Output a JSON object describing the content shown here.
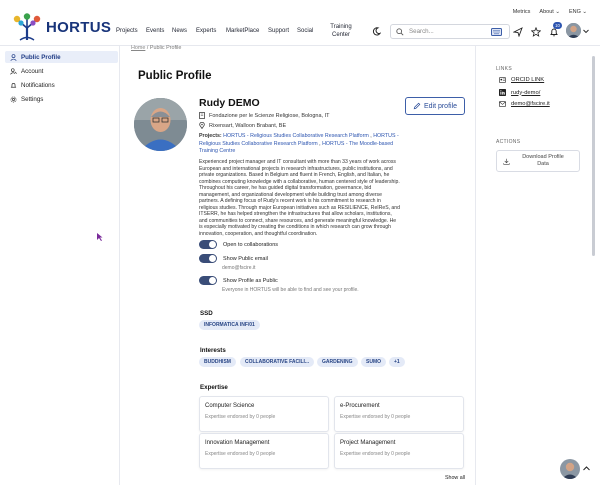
{
  "header": {
    "app_name": "HORTUS",
    "top_links": [
      "Metrics",
      "About ⌄",
      "ENG ⌄"
    ],
    "nav": [
      "Projects",
      "Events",
      "News",
      "Experts",
      "MarketPlace",
      "Support",
      "Social"
    ],
    "nav_training": "Training Center",
    "search_placeholder": "Search...",
    "notification_count": "10"
  },
  "breadcrumb": {
    "home": "Home",
    "sep": " / ",
    "current": "Public Profile"
  },
  "sidebar": {
    "items": [
      {
        "label": "Public Profile",
        "icon": "person-icon",
        "active": true
      },
      {
        "label": "Account",
        "icon": "account-icon",
        "active": false
      },
      {
        "label": "Notifications",
        "icon": "bell-icon",
        "active": false
      },
      {
        "label": "Settings",
        "icon": "gear-icon",
        "active": false
      }
    ]
  },
  "profile": {
    "page_title": "Public Profile",
    "name": "Rudy DEMO",
    "organization": "Fondazione per le Scienze Religiose, Bologna, IT",
    "location": "Rixensart, Walloon Brabant, BE",
    "edit_label": "Edit profile",
    "projects_label": "Projects:",
    "projects": [
      "HORTUS - Religious Studies Collaborative Research Platform",
      "HORTUS - Religious Studies Collaborative Research Platform",
      "HORTUS - The Moodle-based Training Centre"
    ],
    "bio": "Experienced project manager and IT consultant with more than 33 years of work across European and international projects in research infrastructures, public institutions, and private organizations. Based in Belgium and fluent in French, English, and Italian, he combines computing knowledge with a collaborative, human centered style of leadership. Throughout his career, he has guided digital transformation, governance, bid management, and organizational development while building trust among diverse partners. A defining focus of Rudy's recent work is his commitment to research in religious studies. Through major European initiatives such as RESILIENCE, ReIReS, and ITSERR, he has helped strengthen the infrastructures that allow scholars, institutions, and communities to connect, share resources, and generate meaningful knowledge. He is especially motivated by creating the conditions in which research can grow through innovation, cooperation, and thoughtful coordination.",
    "toggles": [
      {
        "label": "Open to collaborations",
        "on": true
      },
      {
        "label": "Show Public email",
        "on": true,
        "sub": "demo@fscire.it"
      },
      {
        "label": "Show Profile as Public",
        "on": true,
        "sub": "Everyone in HORTUS will be able to find and see your profile."
      }
    ],
    "ssd_title": "SSD",
    "ssd": [
      "INFORMATICA INF/01"
    ],
    "interests_title": "Interests",
    "interests": [
      "BUDDHISM",
      "COLLABORATIVE FACILI...",
      "GARDENING",
      "SUMO",
      "+1"
    ],
    "expertise_title": "Expertise",
    "expertise": [
      {
        "title": "Computer Science",
        "sub": "Expertise endorsed by 0 people"
      },
      {
        "title": "e-Procurement",
        "sub": "Expertise endorsed by 0 people"
      },
      {
        "title": "Innovation Management",
        "sub": "Expertise endorsed by 0 people"
      },
      {
        "title": "Project Management",
        "sub": "Expertise endorsed by 0 people"
      }
    ],
    "show_all": "Show all"
  },
  "right_panel": {
    "links_title": "LINKS",
    "links": [
      {
        "label": "ORCID LINK",
        "icon": "orcid-icon"
      },
      {
        "label": "rudy-demo/",
        "icon": "linkedin-icon"
      },
      {
        "label": "demo@fscire.it",
        "icon": "mail-icon"
      }
    ],
    "actions_title": "ACTIONS",
    "download_label": "Download Profile Data"
  },
  "colors": {
    "brand": "#18347a",
    "accent": "#2d55b0",
    "chip_bg": "#e4eaf7",
    "active_bg": "#e9eef9"
  }
}
